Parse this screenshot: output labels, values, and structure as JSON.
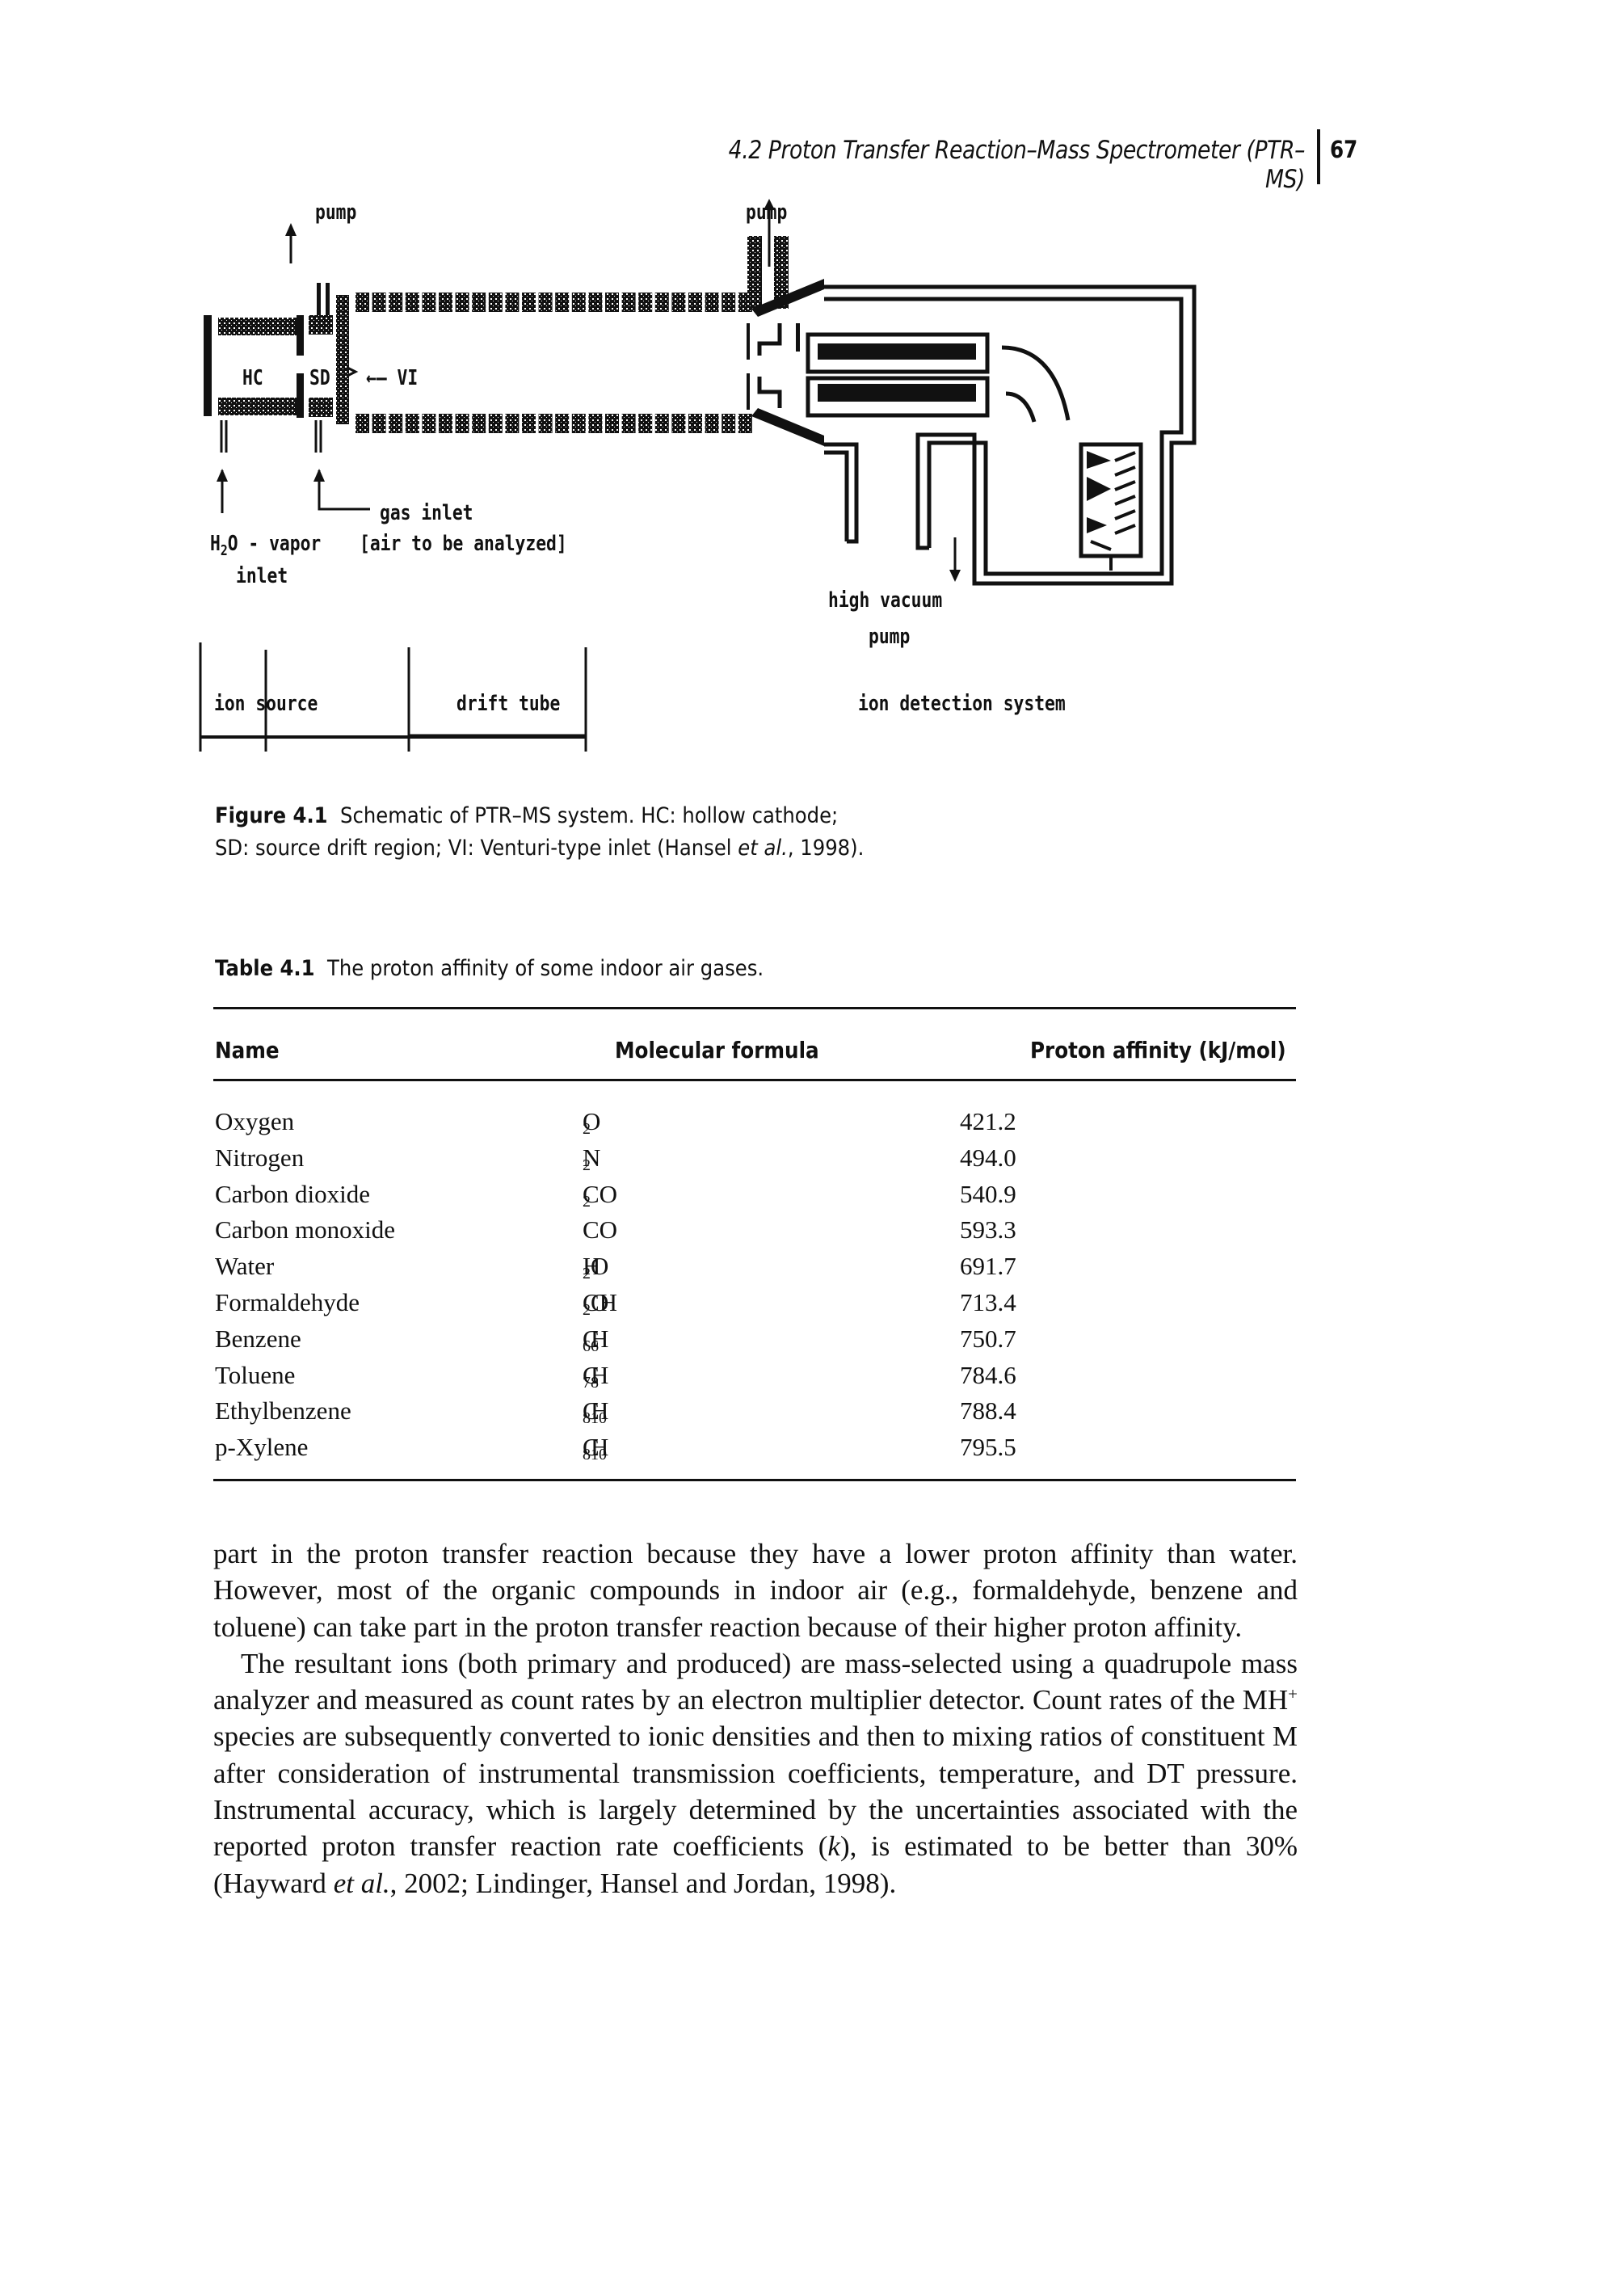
{
  "running_head": {
    "title": "4.2  Proton Transfer Reaction–Mass Spectrometer (PTR–MS)",
    "page_number": "67"
  },
  "figure": {
    "labels": {
      "pump_left": "pump",
      "pump_right": "pump",
      "hc": "HC",
      "sd": "SD",
      "vi_arrow": "←— VI",
      "gas_inlet": "gas inlet",
      "gas_inlet_note": "[air to be analyzed]",
      "h2o_prefix": "H",
      "h2o_sub": "2",
      "h2o_suffix": "O - vapor",
      "h2o_inlet": "inlet",
      "high_vacuum": "high vacuum",
      "high_vacuum_pump": "pump"
    },
    "sections": [
      "ion source",
      "drift tube",
      "ion detection system"
    ],
    "caption_label": "Figure 4.1",
    "caption_text": "Schematic of PTR–MS system. HC: hollow cathode; SD: source drift region; VI: Venturi-type inlet (Hansel ",
    "caption_italic": "et al.",
    "caption_tail": ", 1998)."
  },
  "table": {
    "caption_label": "Table 4.1",
    "caption_text": "The proton affinity of some indoor air gases.",
    "headers": [
      "Name",
      "Molecular formula",
      "Proton affinity (kJ/mol)"
    ],
    "rows": [
      {
        "name": "Oxygen",
        "formula": [
          [
            "O",
            ""
          ],
          [
            "",
            "2"
          ]
        ],
        "pa": "421.2"
      },
      {
        "name": "Nitrogen",
        "formula": [
          [
            "N",
            ""
          ],
          [
            "",
            "2"
          ]
        ],
        "pa": "494.0"
      },
      {
        "name": "Carbon dioxide",
        "formula": [
          [
            "CO",
            ""
          ],
          [
            "",
            "2"
          ]
        ],
        "pa": "540.9"
      },
      {
        "name": "Carbon monoxide",
        "formula": [
          [
            "CO",
            ""
          ]
        ],
        "pa": "593.3"
      },
      {
        "name": "Water",
        "formula": [
          [
            "H",
            ""
          ],
          [
            "",
            "2"
          ],
          [
            "O",
            ""
          ]
        ],
        "pa": "691.7"
      },
      {
        "name": "Formaldehyde",
        "formula": [
          [
            "CH",
            ""
          ],
          [
            "",
            "2"
          ],
          [
            "O",
            ""
          ]
        ],
        "pa": "713.4"
      },
      {
        "name": "Benzene",
        "formula": [
          [
            "C",
            ""
          ],
          [
            "",
            "6"
          ],
          [
            "H",
            ""
          ],
          [
            "",
            "6"
          ]
        ],
        "pa": "750.7"
      },
      {
        "name": "Toluene",
        "formula": [
          [
            "C",
            ""
          ],
          [
            "",
            "7"
          ],
          [
            "H",
            ""
          ],
          [
            "",
            "8"
          ]
        ],
        "pa": "784.6"
      },
      {
        "name": "Ethylbenzene",
        "formula": [
          [
            "C",
            ""
          ],
          [
            "",
            "8"
          ],
          [
            "H",
            ""
          ],
          [
            "",
            "10"
          ]
        ],
        "pa": "788.4"
      },
      {
        "name": "p-Xylene",
        "formula": [
          [
            "C",
            ""
          ],
          [
            "",
            "8"
          ],
          [
            "H",
            ""
          ],
          [
            "",
            "10"
          ]
        ],
        "pa": "795.5"
      }
    ]
  },
  "body": {
    "p1": "part in the proton transfer reaction because they have a lower proton affinity than water. However, most of the organic compounds in indoor air (e.g., formaldehyde, benzene and toluene) can take part in the proton transfer reaction because of their higher proton affinity.",
    "p2_a": "The resultant ions (both primary and produced) are mass-selected using a quadrupole mass analyzer and measured as count rates by an electron multiplier detector. Count rates of the MH",
    "p2_sup": "+",
    "p2_b": " species are subsequently converted to ionic densities and then to mixing ratios of constituent M after consideration of instrumental transmission coefficients, temperature, and DT pressure. Instrumental accuracy, which is largely determined by the uncertainties associated with the reported proton transfer reaction rate coefficients (",
    "p2_k": "k",
    "p2_c": "), is estimated to be better than 30% (Hayward ",
    "p2_etal": "et al.",
    "p2_d": ", 2002; Lindinger, Hansel and Jordan, 1998)."
  }
}
